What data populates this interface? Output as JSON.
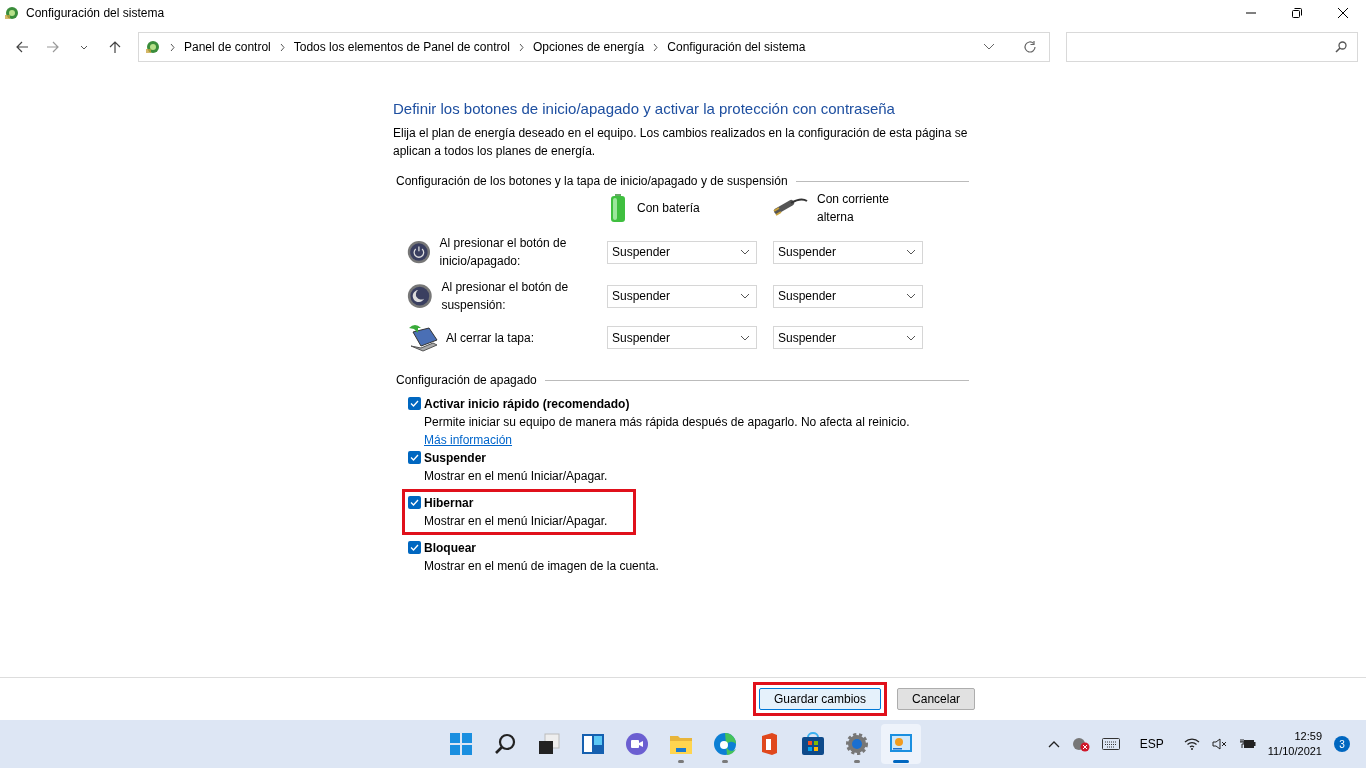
{
  "window": {
    "title": "Configuración del sistema"
  },
  "address_bar": {
    "breadcrumbs": [
      "Panel de control",
      "Todos los elementos de Panel de control",
      "Opciones de energía",
      "Configuración del sistema"
    ]
  },
  "heading": "Definir los botones de inicio/apagado y activar la protección con contraseña",
  "intro": "Elija el plan de energía deseado en el equipo. Los cambios realizados en la configuración de esta página se aplican a todos los planes de energía.",
  "buttons_section": {
    "title": "Configuración de los botones y la tapa de inicio/apagado y de suspensión",
    "columns": [
      {
        "kind": "battery",
        "label": "Con batería"
      },
      {
        "kind": "ac",
        "label": "Con corriente alterna"
      }
    ],
    "rows": [
      {
        "kind": "power",
        "label": "Al presionar el botón de inicio/apagado:",
        "values": [
          "Suspender",
          "Suspender"
        ]
      },
      {
        "kind": "sleep",
        "label": "Al presionar el botón de suspensión:",
        "values": [
          "Suspender",
          "Suspender"
        ]
      },
      {
        "kind": "lid",
        "label": "Al cerrar la tapa:",
        "values": [
          "Suspender",
          "Suspender"
        ]
      }
    ]
  },
  "shutdown_section": {
    "title": "Configuración de apagado",
    "options": [
      {
        "label": "Activar inicio rápido (recomendado)",
        "description": "Permite iniciar su equipo de manera más rápida después de apagarlo. No afecta al reinicio.",
        "link": "Más información",
        "checked": true,
        "highlighted": false
      },
      {
        "label": "Suspender",
        "description": "Mostrar en el menú Iniciar/Apagar.",
        "checked": true,
        "highlighted": false
      },
      {
        "label": "Hibernar",
        "description": "Mostrar en el menú Iniciar/Apagar.",
        "checked": true,
        "highlighted": true
      },
      {
        "label": "Bloquear",
        "description": "Mostrar en el menú de imagen de la cuenta.",
        "checked": true,
        "highlighted": false
      }
    ]
  },
  "footer_buttons": [
    {
      "label": "Guardar cambios",
      "highlighted": true
    },
    {
      "label": "Cancelar",
      "highlighted": false
    }
  ],
  "taskbar": {
    "apps": [
      {
        "kind": "start",
        "running": false,
        "active": false
      },
      {
        "kind": "search",
        "running": false,
        "active": false
      },
      {
        "kind": "taskview",
        "running": false,
        "active": false
      },
      {
        "kind": "widgets",
        "running": false,
        "active": false
      },
      {
        "kind": "chat",
        "running": false,
        "active": false
      },
      {
        "kind": "folder",
        "running": true,
        "active": false
      },
      {
        "kind": "browser",
        "running": true,
        "active": false
      },
      {
        "kind": "office",
        "running": false,
        "active": false
      },
      {
        "kind": "store",
        "running": false,
        "active": false
      },
      {
        "kind": "settings",
        "running": true,
        "active": false
      },
      {
        "kind": "controlpanel",
        "running": true,
        "active": true
      }
    ],
    "language": "ESP",
    "time": "12:59",
    "date": "11/10/2021",
    "notifications": "3"
  }
}
